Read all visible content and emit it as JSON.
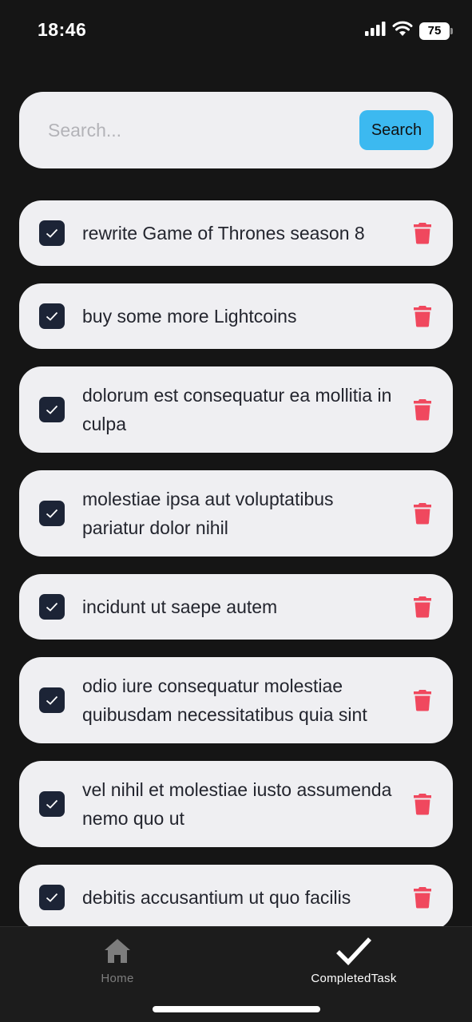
{
  "status_bar": {
    "time": "18:46",
    "battery": "75"
  },
  "search": {
    "placeholder": "Search...",
    "value": "",
    "button_label": "Search"
  },
  "tasks": [
    {
      "text": "rewrite Game of Thrones season 8",
      "completed": true
    },
    {
      "text": "buy some more Lightcoins",
      "completed": true
    },
    {
      "text": "dolorum est consequatur ea mollitia in culpa",
      "completed": true
    },
    {
      "text": "molestiae ipsa aut voluptatibus pariatur dolor nihil",
      "completed": true
    },
    {
      "text": "incidunt ut saepe autem",
      "completed": true
    },
    {
      "text": "odio iure consequatur molestiae quibusdam necessitatibus quia sint",
      "completed": true
    },
    {
      "text": "vel nihil et molestiae iusto assumenda nemo quo ut",
      "completed": true
    },
    {
      "text": "debitis accusantium ut quo facilis",
      "completed": true
    }
  ],
  "tab_bar": {
    "tabs": [
      {
        "label": "Home",
        "icon": "home-icon",
        "active": false
      },
      {
        "label": "CompletedTask",
        "icon": "checkmark-icon",
        "active": true
      }
    ]
  },
  "colors": {
    "background": "#151515",
    "card": "#efeff2",
    "accent_button": "#3cb9f0",
    "checkbox": "#1c2436",
    "delete": "#f0485e",
    "tab_inactive": "#7d7d7d",
    "tab_active": "#ffffff"
  }
}
